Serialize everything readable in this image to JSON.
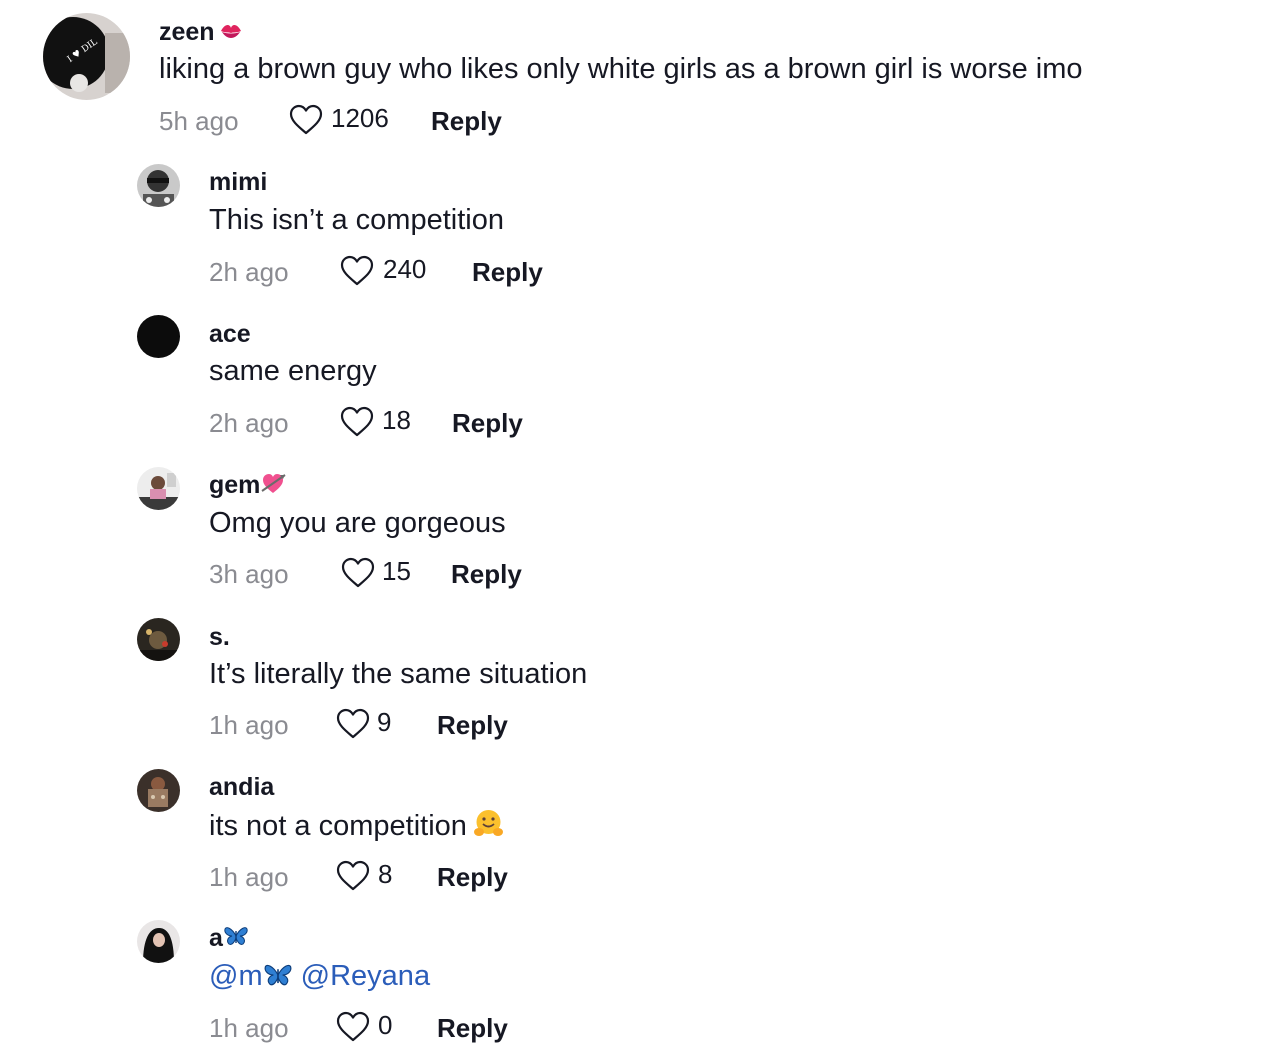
{
  "comments": [
    {
      "username": "zeen",
      "username_emoji": "kiss-mark-icon",
      "text": "liking a brown guy who likes only white girls as a brown girl is worse imo",
      "time": "5h ago",
      "likes": "1206",
      "reply_label": "Reply"
    },
    {
      "username": "mimi",
      "text": "This isn’t a competition",
      "time": "2h ago",
      "likes": "240",
      "reply_label": "Reply"
    },
    {
      "username": "ace",
      "text": "same energy",
      "time": "2h ago",
      "likes": "18",
      "reply_label": "Reply"
    },
    {
      "username": "gem",
      "username_emoji": "heart-with-arrow-icon",
      "text": "Omg you are gorgeous",
      "time": "3h ago",
      "likes": "15",
      "reply_label": "Reply"
    },
    {
      "username": "s.",
      "text": "It’s literally the same situation",
      "time": "1h ago",
      "likes": "9",
      "reply_label": "Reply"
    },
    {
      "username": "andia",
      "text": "its not a competition",
      "text_emoji": "hugging-face-icon",
      "time": "1h ago",
      "likes": "8",
      "reply_label": "Reply"
    },
    {
      "username": "a",
      "username_emoji": "butterfly-icon",
      "mention_1": "@m",
      "mention_1_emoji": "butterfly-icon",
      "mention_2": "@Reyana",
      "time": "1h ago",
      "likes": "0",
      "reply_label": "Reply"
    }
  ],
  "colors": {
    "text": "#161823",
    "muted": "#8a8b91",
    "mention": "#2b5db9"
  }
}
